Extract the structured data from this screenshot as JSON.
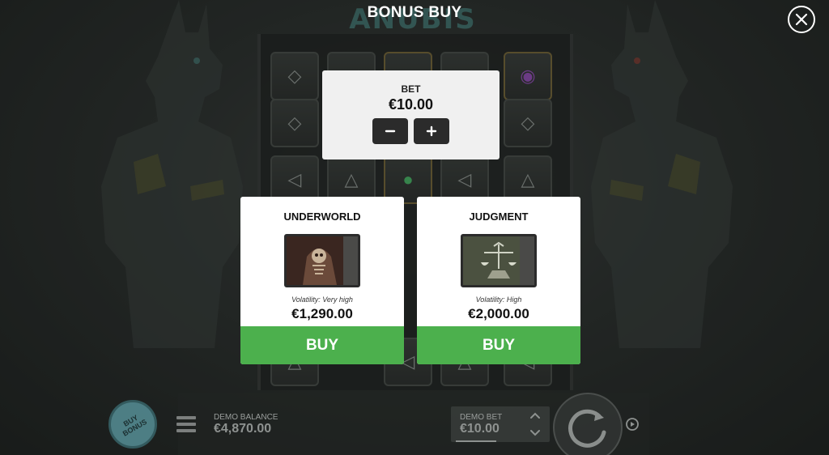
{
  "game": {
    "logo_text": "ANUBIS"
  },
  "modal": {
    "title": "BONUS BUY",
    "close_icon": "close-icon"
  },
  "bet_panel": {
    "label": "BET",
    "value": "€10.00",
    "decrease_icon": "minus-icon",
    "increase_icon": "plus-icon"
  },
  "bonus_cards": [
    {
      "title": "UNDERWORLD",
      "image": "skeleton-reaper-image",
      "volatility": "Volatility: Very high",
      "price": "€1,290.00",
      "buy_label": "BUY"
    },
    {
      "title": "JUDGMENT",
      "image": "scales-of-judgment-image",
      "volatility": "Volatility: High",
      "price": "€2,000.00",
      "buy_label": "BUY"
    }
  ],
  "bottom_bar": {
    "buy_bonus_label": "BUY BONUS",
    "balance_label": "DEMO BALANCE",
    "balance_value": "€4,870.00",
    "bet_label": "DEMO BET",
    "bet_value": "€10.00"
  },
  "colors": {
    "buy_green": "#4cb04d",
    "panel_bg": "#f0f0f0",
    "card_bg": "#ffffff",
    "buy_bonus_teal": "#5e9ea7"
  }
}
